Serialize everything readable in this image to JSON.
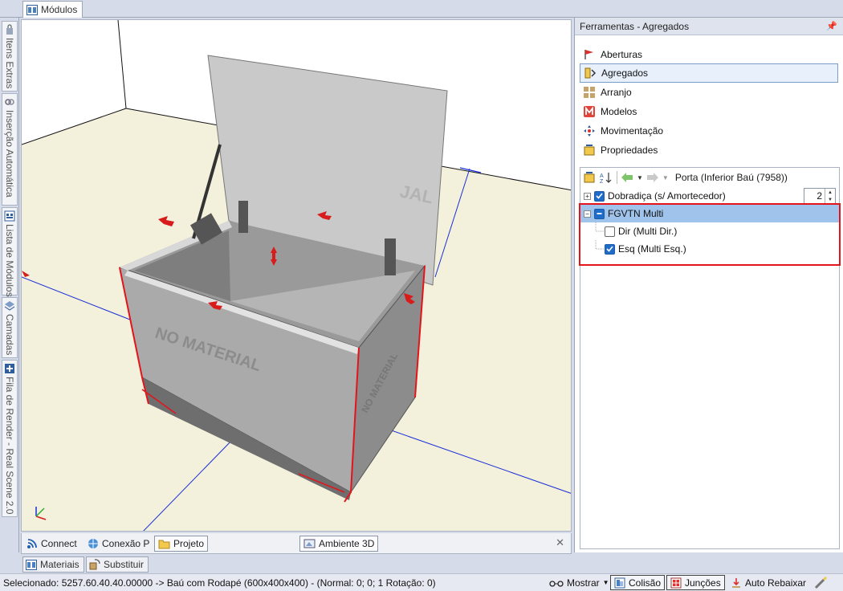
{
  "top_tab": {
    "label": "Módulos"
  },
  "left_tabs": [
    {
      "label": "Itens Extras",
      "icon": "bag-icon"
    },
    {
      "label": "Inserção Automática",
      "icon": "link-icon"
    },
    {
      "label": "Lista de Módulos",
      "icon": "list-icon"
    },
    {
      "label": "Camadas",
      "icon": "layers-icon"
    },
    {
      "label": "Fila de Render - Real Scene 2.0",
      "icon": "render-icon"
    }
  ],
  "viewport": {
    "texture_front": "NO MATERIAL",
    "texture_side": "NO MATERIAL",
    "texture_lid": "JAL"
  },
  "doc_tabs": [
    {
      "label": "Connect",
      "icon": "rss-icon"
    },
    {
      "label": "Conexão P",
      "icon": "globe-icon"
    },
    {
      "label": "Projeto",
      "icon": "folder-icon"
    },
    {
      "label": "Ambiente 3D",
      "icon": "scene-icon"
    }
  ],
  "bottom_tabs": [
    {
      "label": "Materiais",
      "icon": "materials-icon"
    },
    {
      "label": "Substituir",
      "icon": "replace-icon"
    }
  ],
  "status": {
    "text": "Selecionado: 5257.60.40.40.00000 -> Baú com Rodapé (600x400x400) - (Normal: 0; 0; 1 Rotação: 0)",
    "mostrar": "Mostrar",
    "colisao": "Colisão",
    "juncoes": "Junções",
    "auto_rebaixar": "Auto Rebaixar"
  },
  "panel": {
    "title": "Ferramentas - Agregados",
    "items": [
      {
        "label": "Aberturas",
        "icon": "aberturas-icon"
      },
      {
        "label": "Agregados",
        "icon": "agregados-icon"
      },
      {
        "label": "Arranjo",
        "icon": "arranjo-icon"
      },
      {
        "label": "Modelos",
        "icon": "modelos-icon"
      },
      {
        "label": "Movimentação",
        "icon": "move-icon"
      },
      {
        "label": "Propriedades",
        "icon": "props-icon"
      }
    ],
    "active_item": "Agregados",
    "props_title": "Porta (Inferior Baú (7958))",
    "tree": [
      {
        "label": "Dobradiça (s/ Amortecedor)",
        "value": "2",
        "checked": true
      },
      {
        "label": "FGVTN Multi",
        "checked": "partial",
        "selected": true
      },
      {
        "label": "Dir (Multi Dir.)",
        "checked": false
      },
      {
        "label": "Esq (Multi Esq.)",
        "checked": true
      }
    ]
  },
  "colors": {
    "accent": "#1f6cc9",
    "selection": "#9fc3ea",
    "highlight_frame": "#e3141b"
  }
}
